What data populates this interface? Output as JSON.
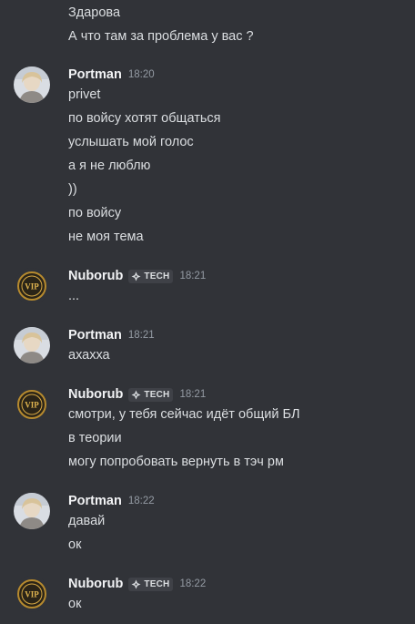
{
  "messages": [
    {
      "continuation": true,
      "lines": [
        "Здарова",
        "А что там за проблема у вас ?"
      ]
    },
    {
      "author": "Portman",
      "avatar": "portman-avatar",
      "time": "18:20",
      "lines": [
        "privet",
        "по войсу хотят общаться",
        "услышать мой голос",
        "а я не люблю",
        "))",
        "по войсу",
        "не моя тема"
      ]
    },
    {
      "author": "Nuborub",
      "avatar": "vip-avatar",
      "tag": "TECH",
      "time": "18:21",
      "lines": [
        "..."
      ]
    },
    {
      "author": "Portman",
      "avatar": "portman-avatar",
      "time": "18:21",
      "lines": [
        "ахахха"
      ]
    },
    {
      "author": "Nuborub",
      "avatar": "vip-avatar",
      "tag": "TECH",
      "time": "18:21",
      "lines": [
        "смотри, у тебя сейчас идёт общий БЛ",
        "в теории",
        "могу попробовать вернуть в тэч рм"
      ]
    },
    {
      "author": "Portman",
      "avatar": "portman-avatar",
      "time": "18:22",
      "lines": [
        "давай",
        "ок"
      ]
    },
    {
      "author": "Nuborub",
      "avatar": "vip-avatar",
      "tag": "TECH",
      "time": "18:22",
      "lines": [
        "ок"
      ]
    }
  ],
  "colors": {
    "background": "#313338",
    "text": "#dbdee1",
    "username": "#f2f3f5",
    "timestamp": "#949ba4",
    "tag_background": "#3f4147"
  }
}
